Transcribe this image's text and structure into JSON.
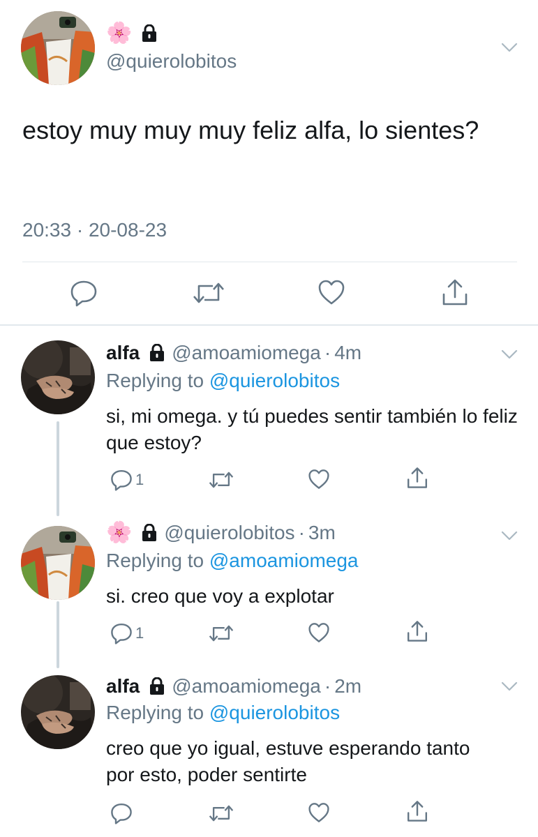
{
  "main_tweet": {
    "name_emoji": "🌸",
    "handle": "@quierolobitos",
    "text": "estoy muy muy muy feliz alfa, lo sientes?",
    "timestamp": "20:33 · 20-08-23",
    "icons": [
      "reply-icon",
      "retweet-icon",
      "like-icon",
      "share-icon"
    ]
  },
  "replies": [
    {
      "name": "alfa",
      "handle": "@amoamiomega",
      "dot": "·",
      "time": "4m",
      "replying_prefix": "Replying to ",
      "replying_to": "@quierolobitos",
      "text": "si, mi omega. y tú puedes sentir también lo feliz que estoy?",
      "reply_count": "1"
    },
    {
      "name_emoji": "🌸",
      "handle": "@quierolobitos",
      "dot": "·",
      "time": "3m",
      "replying_prefix": "Replying to ",
      "replying_to": "@amoamiomega",
      "text": "si. creo que voy a explotar",
      "reply_count": "1"
    },
    {
      "name": "alfa",
      "handle": "@amoamiomega",
      "dot": "·",
      "time": "2m",
      "replying_prefix": "Replying to ",
      "replying_to": "@quierolobitos",
      "text": "creo que yo igual, estuve esperando tanto por esto, poder sentirte",
      "reply_count": ""
    }
  ],
  "colors": {
    "text": "#14171a",
    "secondary": "#657786",
    "link": "#1b95e0",
    "divider": "#e1e8ed",
    "thread_line": "#ccd6dd"
  }
}
